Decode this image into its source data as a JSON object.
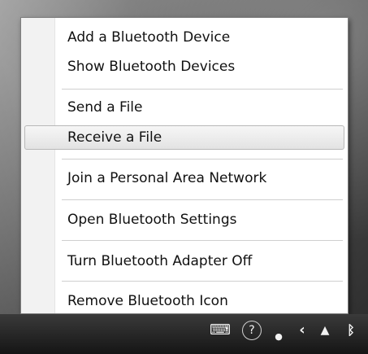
{
  "menu": {
    "items": [
      {
        "label": "Add a Bluetooth Device"
      },
      {
        "label": "Show Bluetooth Devices"
      },
      {
        "label": "Send a File"
      },
      {
        "label": "Receive a File"
      },
      {
        "label": "Join a Personal Area Network"
      },
      {
        "label": "Open Bluetooth Settings"
      },
      {
        "label": "Turn Bluetooth Adapter Off"
      },
      {
        "label": "Remove Bluetooth Icon"
      }
    ],
    "hovered_item": "Receive a File"
  },
  "tray": {
    "icons": [
      "keyboard-icon",
      "help-icon",
      "dot-icon",
      "chevron-left-icon",
      "network-icon",
      "bluetooth-icon"
    ]
  }
}
